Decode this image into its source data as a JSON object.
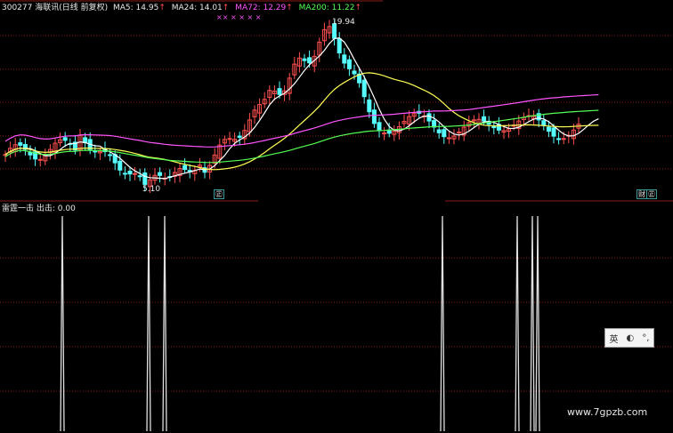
{
  "header": {
    "code": "300277",
    "name": "海联讯(日线 前复权)",
    "ma5": "MA5: 14.95",
    "ma24": "MA24: 14.01",
    "ma72": "MA72: 12.29",
    "ma200": "MA200: 11.22",
    "up_arrow": "↑",
    "markers": "×× × × × ×"
  },
  "price_panel": {
    "high_label": "19.94",
    "low_label": "5.10",
    "event_mark_1": "㊣",
    "event_mark_2": "财",
    "event_mark_3": "㊣"
  },
  "indicator_panel": {
    "title": "雷霆一击 出击: 0.00"
  },
  "ime_toolbar": {
    "lang": "英",
    "moon": "◐",
    "punct": "°,"
  },
  "watermark": "www.7gpzb.com",
  "colors": {
    "up": "#ff5050",
    "down": "#55ffff",
    "ma5": "#ffffff",
    "ma24": "#ffff55",
    "ma72": "#ff55ff",
    "ma200": "#55ff55",
    "signal": "#e0e0e0",
    "grid": "#8b1a1a"
  },
  "chart_data": {
    "type": "line",
    "title": "雷霆一击 出击",
    "signal_count": 7
  }
}
